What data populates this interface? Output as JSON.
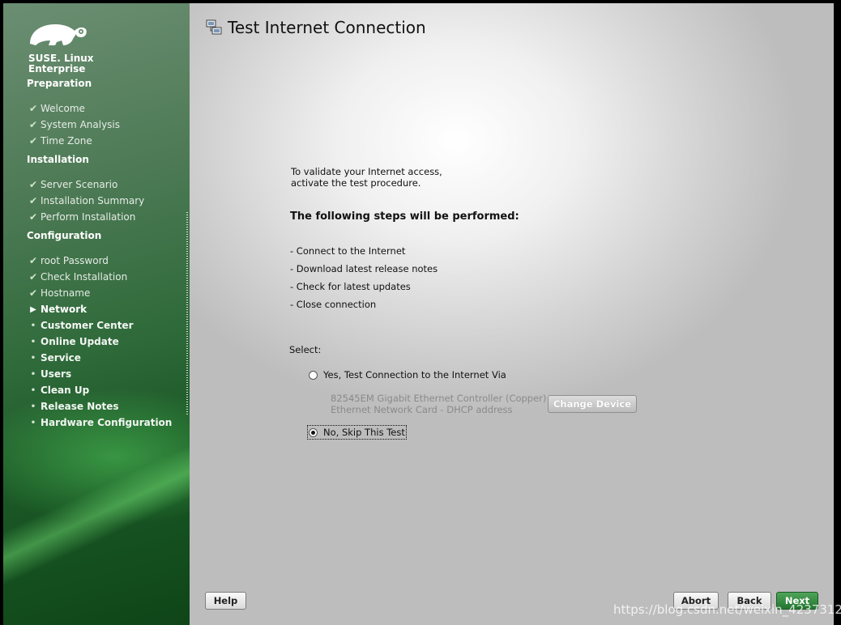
{
  "brand": {
    "line1": "SUSE. Linux",
    "line2": "Enterprise",
    "logo_icon": "gecko-icon"
  },
  "sections": {
    "preparation": "Preparation",
    "installation": "Installation",
    "configuration": "Configuration"
  },
  "steps": {
    "preparation": [
      {
        "label": "Welcome",
        "state": "done"
      },
      {
        "label": "System Analysis",
        "state": "done"
      },
      {
        "label": "Time Zone",
        "state": "done"
      }
    ],
    "installation": [
      {
        "label": "Server Scenario",
        "state": "done"
      },
      {
        "label": "Installation Summary",
        "state": "done"
      },
      {
        "label": "Perform Installation",
        "state": "done"
      }
    ],
    "configuration": [
      {
        "label": "root Password",
        "state": "done"
      },
      {
        "label": "Check Installation",
        "state": "done"
      },
      {
        "label": "Hostname",
        "state": "done"
      },
      {
        "label": "Network",
        "state": "current"
      },
      {
        "label": "Customer Center",
        "state": "todo"
      },
      {
        "label": "Online Update",
        "state": "todo"
      },
      {
        "label": "Service",
        "state": "todo"
      },
      {
        "label": "Users",
        "state": "todo"
      },
      {
        "label": "Clean Up",
        "state": "todo"
      },
      {
        "label": "Release Notes",
        "state": "todo"
      },
      {
        "label": "Hardware Configuration",
        "state": "todo"
      }
    ]
  },
  "icons": {
    "done": "✔",
    "current": "▶",
    "todo": "•"
  },
  "page": {
    "title": "Test Internet Connection",
    "title_icon": "network-test-icon",
    "intro_line1": "To validate your Internet access,",
    "intro_line2": "activate the test procedure.",
    "steps_heading": "The following steps will be performed:",
    "procedure": [
      "- Connect to the Internet",
      "- Download latest release notes",
      "- Check for latest updates",
      "- Close connection"
    ],
    "select_label": "Select:",
    "option_yes": "Yes, Test Connection to the Internet Via",
    "option_no": "No, Skip This Test",
    "selected": "no",
    "device_line1": "82545EM Gigabit Ethernet Controller (Copper)",
    "device_line2": "Ethernet Network Card - DHCP address",
    "change_device": "Change Device"
  },
  "buttons": {
    "help": "Help",
    "abort": "Abort",
    "back": "Back",
    "next": "Next"
  },
  "watermark": "https://blog.csdn.net/weixin_42373127"
}
